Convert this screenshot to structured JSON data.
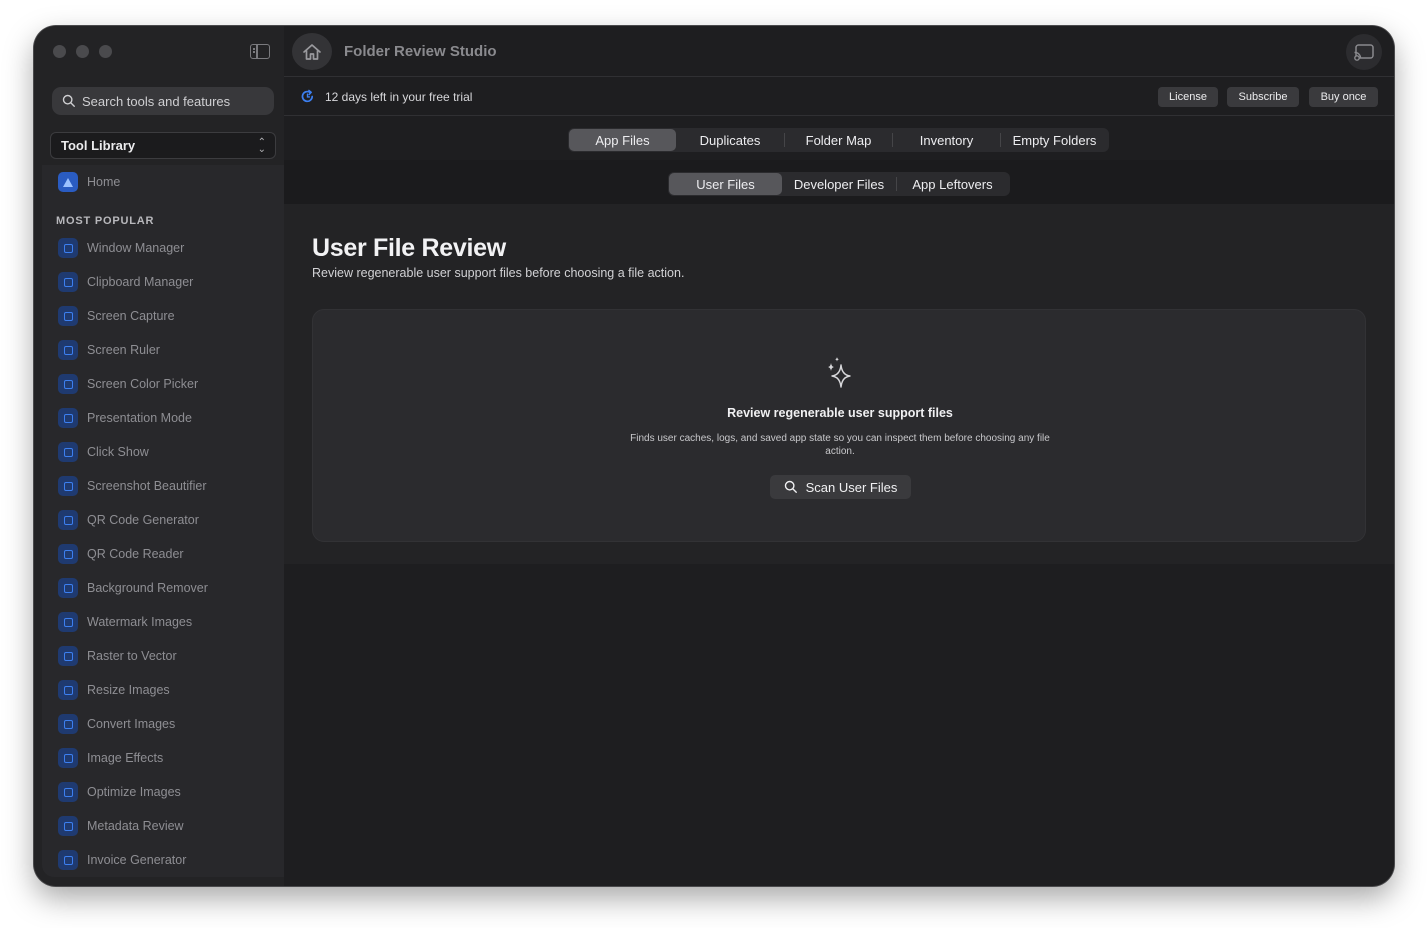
{
  "app": {
    "title": "Folder Review Studio"
  },
  "sidebar": {
    "search_placeholder": "Search tools and features",
    "library_label": "Tool Library",
    "home_label": "Home",
    "section_header": "MOST POPULAR",
    "items": [
      {
        "label": "Window Manager"
      },
      {
        "label": "Clipboard Manager"
      },
      {
        "label": "Screen Capture"
      },
      {
        "label": "Screen Ruler"
      },
      {
        "label": "Screen Color Picker"
      },
      {
        "label": "Presentation Mode"
      },
      {
        "label": "Click Show"
      },
      {
        "label": "Screenshot Beautifier"
      },
      {
        "label": "QR Code Generator"
      },
      {
        "label": "QR Code Reader"
      },
      {
        "label": "Background Remover"
      },
      {
        "label": "Watermark Images"
      },
      {
        "label": "Raster to Vector"
      },
      {
        "label": "Resize Images"
      },
      {
        "label": "Convert Images"
      },
      {
        "label": "Image Effects"
      },
      {
        "label": "Optimize Images"
      },
      {
        "label": "Metadata Review"
      },
      {
        "label": "Invoice Generator"
      }
    ]
  },
  "trial": {
    "text": "12 days left in your free trial",
    "license": "License",
    "subscribe": "Subscribe",
    "buy_once": "Buy once"
  },
  "tabs": {
    "items": [
      "App Files",
      "Duplicates",
      "Folder Map",
      "Inventory",
      "Empty Folders"
    ],
    "selected": "App Files"
  },
  "subtabs": {
    "items": [
      "User Files",
      "Developer Files",
      "App Leftovers"
    ],
    "selected": "User Files"
  },
  "page": {
    "title": "User File Review",
    "subtitle": "Review regenerable user support files before choosing a file action."
  },
  "card": {
    "title": "Review regenerable user support files",
    "description": "Finds user caches, logs, and saved app state so you can inspect them before choosing any file action.",
    "button": "Scan User Files"
  },
  "colors": {
    "accent_blue": "#3c7ff0",
    "window_bg": "#1e1e20",
    "sidebar_bg": "#232325"
  }
}
